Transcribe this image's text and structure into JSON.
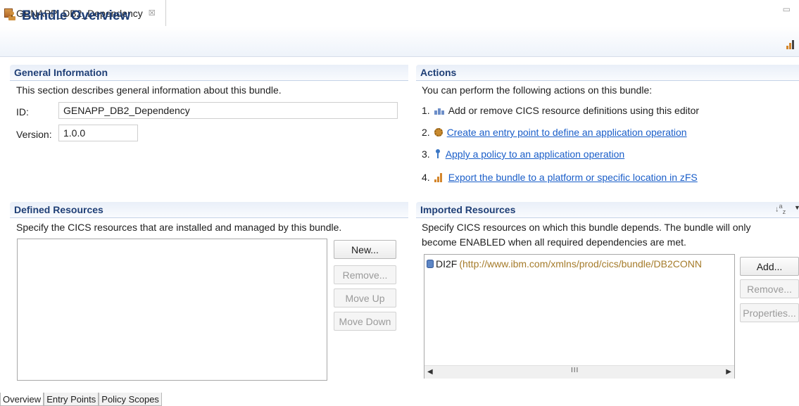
{
  "editor_tab": {
    "title": "GENAPP_DB2_Dependency",
    "close_glyph": "☒"
  },
  "page": {
    "title": "Bundle Overview"
  },
  "general_info": {
    "heading": "General Information",
    "description": "This section describes general information about this bundle.",
    "id_label": "ID:",
    "id_value": "GENAPP_DB2_Dependency",
    "version_label": "Version:",
    "version_value": "1.0.0"
  },
  "actions": {
    "heading": "Actions",
    "description": "You can perform the following actions on this bundle:",
    "items": [
      {
        "number": "1.",
        "icon": "resource-definitions-icon",
        "text": "Add or remove CICS resource definitions using this editor",
        "is_link": false
      },
      {
        "number": "2.",
        "icon": "entry-point-gear-icon",
        "text": "Create an entry point to define an application operation",
        "is_link": true
      },
      {
        "number": "3.",
        "icon": "policy-icon",
        "text": "Apply a policy to an application operation",
        "is_link": true
      },
      {
        "number": "4.",
        "icon": "export-bundle-icon",
        "text": "Export the bundle to a platform or specific location in zFS",
        "is_link": true
      }
    ]
  },
  "defined_resources": {
    "heading": "Defined Resources",
    "description": "Specify the CICS resources that are installed and managed by this bundle.",
    "buttons": {
      "new": "New...",
      "remove": "Remove...",
      "move_up": "Move Up",
      "move_down": "Move Down"
    }
  },
  "imported_resources": {
    "heading": "Imported Resources",
    "description_line1": "Specify CICS resources on which this bundle depends. The bundle will only",
    "description_line2": "become ENABLED when all required dependencies are met.",
    "items": [
      {
        "name": "DI2F",
        "type_url": "(http://www.ibm.com/xmlns/prod/cics/bundle/DB2CONN"
      }
    ],
    "buttons": {
      "add": "Add...",
      "remove": "Remove...",
      "properties": "Properties..."
    },
    "scroll_grip": "III"
  },
  "bottom_tabs": [
    "Overview",
    "Entry Points",
    "Policy Scopes"
  ],
  "colors": {
    "section_title": "#1f3f76",
    "link": "#1a5ec9",
    "url_text": "#a57b2a"
  }
}
